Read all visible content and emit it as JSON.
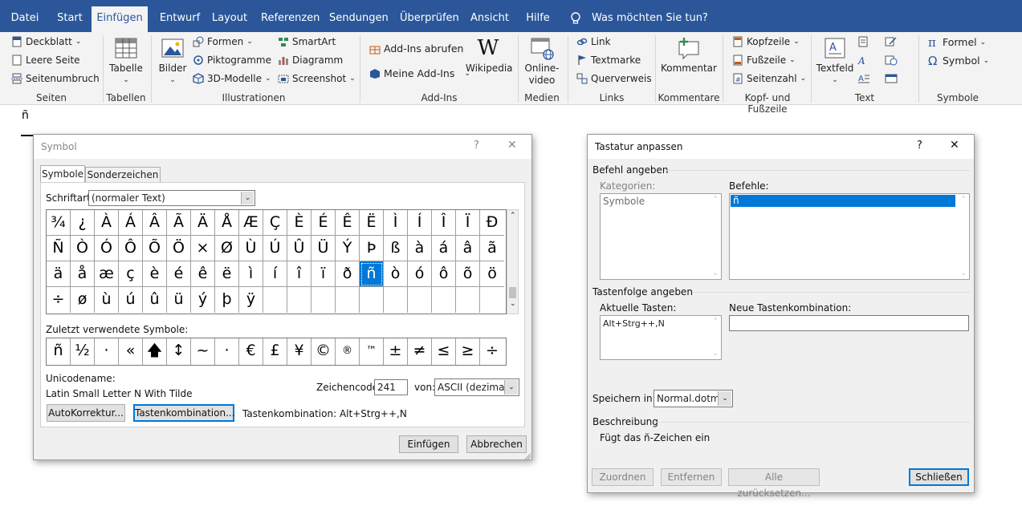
{
  "ribbon_tabs": [
    {
      "label": "Datei"
    },
    {
      "label": "Start"
    },
    {
      "label": "Einfügen",
      "active": true
    },
    {
      "label": "Entwurf"
    },
    {
      "label": "Layout"
    },
    {
      "label": "Referenzen"
    },
    {
      "label": "Sendungen"
    },
    {
      "label": "Überprüfen"
    },
    {
      "label": "Ansicht"
    },
    {
      "label": "Hilfe"
    }
  ],
  "tell_me": "Was möchten Sie tun?",
  "groups": {
    "seiten": {
      "label": "Seiten",
      "items": [
        "Deckblatt",
        "Leere Seite",
        "Seitenumbruch"
      ]
    },
    "tabellen": {
      "label": "Tabellen",
      "button": "Tabelle"
    },
    "illustrationen": {
      "label": "Illustrationen",
      "bilder": "Bilder",
      "items": [
        "Formen",
        "Piktogramme",
        "3D-Modelle",
        "SmartArt",
        "Diagramm",
        "Screenshot"
      ]
    },
    "addins": {
      "label": "Add-Ins",
      "items": [
        "Add-Ins abrufen",
        "Meine Add-Ins"
      ],
      "wikipedia": "Wikipedia"
    },
    "medien": {
      "label": "Medien",
      "button_line1": "Online-",
      "button_line2": "video"
    },
    "links": {
      "label": "Links",
      "items": [
        "Link",
        "Textmarke",
        "Querverweis"
      ]
    },
    "kommentare": {
      "label": "Kommentare",
      "button": "Kommentar"
    },
    "kopf": {
      "label": "Kopf- und Fußzeile",
      "items": [
        "Kopfzeile",
        "Fußzeile",
        "Seitenzahl"
      ]
    },
    "text": {
      "label": "Text",
      "button": "Textfeld"
    },
    "symbole": {
      "label": "Symbole",
      "items": [
        "Formel",
        "Symbol"
      ]
    }
  },
  "document": {
    "char": "ñ"
  },
  "symbol_dialog": {
    "title": "Symbol",
    "help": "?",
    "close": "✕",
    "tabs": [
      "Symbole",
      "Sonderzeichen"
    ],
    "font_label": "Schriftart:",
    "font_value": "(normaler Text)",
    "rows": [
      [
        "¾",
        "¿",
        "À",
        "Á",
        "Â",
        "Ã",
        "Ä",
        "Å",
        "Æ",
        "Ç",
        "È",
        "É",
        "Ê",
        "Ë",
        "Ì",
        "Í",
        "Î",
        "Ï",
        "Ð"
      ],
      [
        "Ñ",
        "Ò",
        "Ó",
        "Ô",
        "Õ",
        "Ö",
        "×",
        "Ø",
        "Ù",
        "Ú",
        "Û",
        "Ü",
        "Ý",
        "Þ",
        "ß",
        "à",
        "á",
        "â",
        "ã"
      ],
      [
        "ä",
        "å",
        "æ",
        "ç",
        "è",
        "é",
        "ê",
        "ë",
        "ì",
        "í",
        "î",
        "ï",
        "ð",
        "ñ",
        "ò",
        "ó",
        "ô",
        "õ",
        "ö"
      ],
      [
        "÷",
        "ø",
        "ù",
        "ú",
        "û",
        "ü",
        "ý",
        "þ",
        "ÿ",
        "",
        "",
        "",
        "",
        "",
        "",
        "",
        "",
        "",
        ""
      ]
    ],
    "selected": "ñ",
    "recent_label": "Zuletzt verwendete Symbole:",
    "recent": [
      "ñ",
      "½",
      "·",
      "«",
      "🡅",
      "↕",
      "~",
      "·",
      "€",
      "£",
      "¥",
      "©",
      "®",
      "™",
      "±",
      "≠",
      "≤",
      "≥",
      "÷"
    ],
    "unicode_label": "Unicodename:",
    "unicode_value": "Latin Small Letter N With Tilde",
    "code_label": "Zeichencode:",
    "code_value": "241",
    "from_label": "von:",
    "from_value": "ASCII (dezimal)",
    "autocorrect": "AutoKorrektur...",
    "shortcut_btn": "Tastenkombination...",
    "shortcut_text": "Tastenkombination: Alt+Strg++,N",
    "insert": "Einfügen",
    "cancel": "Abbrechen"
  },
  "keyboard_dialog": {
    "title": "Tastatur anpassen",
    "help": "?",
    "close": "✕",
    "cmd_section": "Befehl angeben",
    "categories_label": "Kategorien:",
    "categories": [
      "Symbole"
    ],
    "commands_label": "Befehle:",
    "commands": [
      "ñ"
    ],
    "keys_section": "Tastenfolge angeben",
    "current_label": "Aktuelle Tasten:",
    "current": [
      "Alt+Strg++,N"
    ],
    "new_label": "Neue Tastenkombination:",
    "new_value": "",
    "save_label": "Speichern in:",
    "save_value": "Normal.dotm",
    "desc_label": "Beschreibung",
    "desc_value": "Fügt das ñ-Zeichen ein",
    "assign": "Zuordnen",
    "remove": "Entfernen",
    "reset": "Alle zurücksetzen...",
    "close_btn": "Schließen"
  }
}
